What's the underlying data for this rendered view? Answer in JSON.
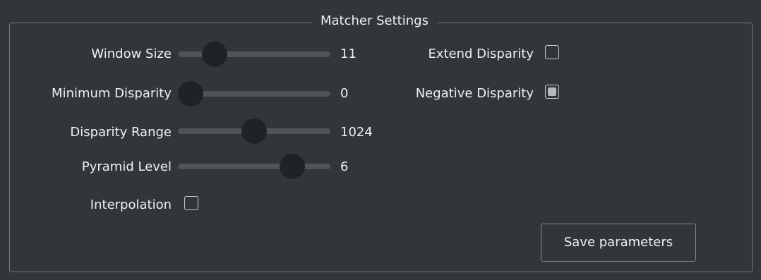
{
  "group": {
    "title": "Matcher Settings"
  },
  "sliders": [
    {
      "label": "Window Size",
      "value": "11",
      "level": 0.19
    },
    {
      "label": "Minimum Disparity",
      "value": "0",
      "level": 0.0
    },
    {
      "label": "Disparity Range",
      "value": "1024",
      "level": 0.5
    },
    {
      "label": "Pyramid Level",
      "value": "6",
      "level": 0.8
    }
  ],
  "checkboxes": {
    "interpolation": {
      "label": "Interpolation",
      "checked": false
    },
    "extend_disparity": {
      "label": "Extend Disparity",
      "checked": false
    },
    "negative_disparity": {
      "label": "Negative Disparity",
      "checked": true
    }
  },
  "buttons": {
    "save_label": "Save parameters"
  },
  "colors": {
    "background": "#31363b",
    "text": "#eff0f1",
    "border": "#76797c",
    "slider_groove": "#4f5459",
    "slider_handle": "#1f2327"
  }
}
